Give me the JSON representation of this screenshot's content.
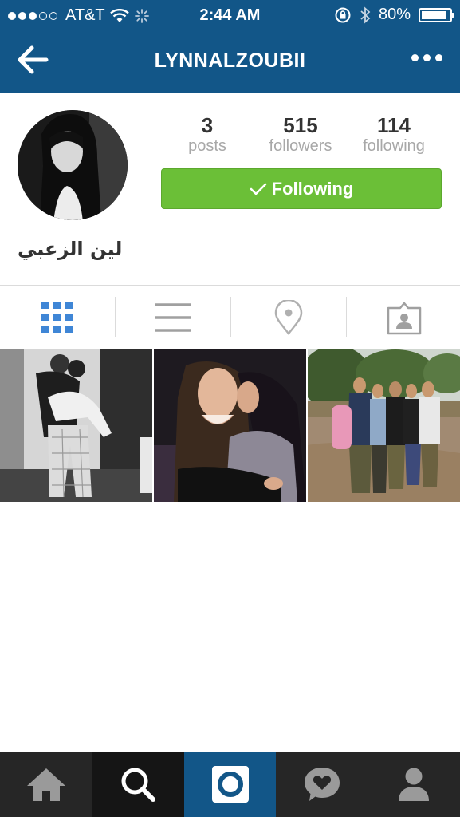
{
  "status_bar": {
    "carrier": "AT&T",
    "time": "2:44 AM",
    "battery": "80%"
  },
  "nav": {
    "title": "LYNNALZOUBII"
  },
  "profile": {
    "full_name": "لين الزعبي",
    "stats": [
      {
        "value": "3",
        "label": "posts"
      },
      {
        "value": "515",
        "label": "followers"
      },
      {
        "value": "114",
        "label": "following"
      }
    ],
    "follow_button": "Following"
  },
  "tabs": [
    {
      "icon": "grid-icon",
      "active": true
    },
    {
      "icon": "list-icon",
      "active": false
    },
    {
      "icon": "location-pin-icon",
      "active": false
    },
    {
      "icon": "tagged-photos-icon",
      "active": false
    }
  ],
  "bottom_nav": [
    {
      "icon": "home-icon",
      "active": false
    },
    {
      "icon": "search-icon",
      "active": true
    },
    {
      "icon": "camera-icon",
      "active": false
    },
    {
      "icon": "activity-icon",
      "active": false
    },
    {
      "icon": "profile-icon",
      "active": false
    }
  ],
  "colors": {
    "header": "#125688",
    "follow_button": "#6bbf37",
    "active_tab": "#3f86d6",
    "bottom_bar": "#262626",
    "camera_button": "#125688"
  }
}
